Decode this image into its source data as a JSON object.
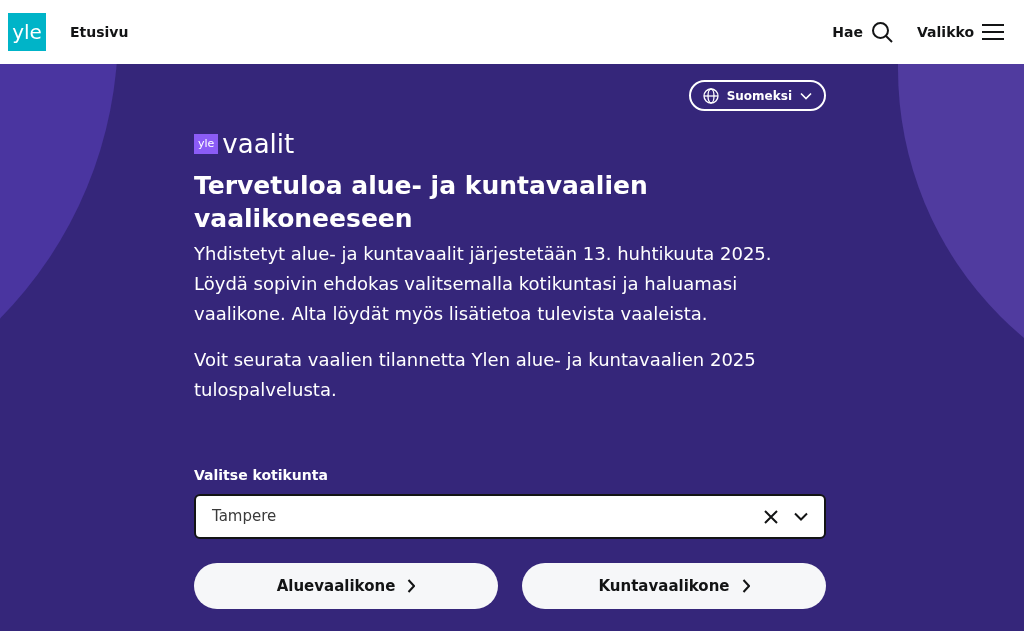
{
  "header": {
    "logo": "yle",
    "nav_link": "Etusivu",
    "search": "Hae",
    "menu": "Valikko"
  },
  "language": "Suomeksi",
  "brand": {
    "badge": "yle",
    "name": "vaalit"
  },
  "title": "Tervetuloa alue- ja kuntavaalien vaalikoneeseen",
  "paragraphs": [
    "Yhdistetyt alue- ja kuntavaalit järjestetään 13. huhtikuuta 2025. Löydä sopivin ehdokas valitsemalla kotikuntasi ja haluamasi vaalikone. Alta löydät myös lisätietoa tulevista vaaleista.",
    "Voit seurata vaalien tilannetta Ylen alue- ja kuntavaalien 2025 tulospalvelusta."
  ],
  "municipality": {
    "label": "Valitse kotikunta",
    "value": "Tampere"
  },
  "buttons": [
    "Aluevaalikone",
    "Kuntavaalikone"
  ]
}
